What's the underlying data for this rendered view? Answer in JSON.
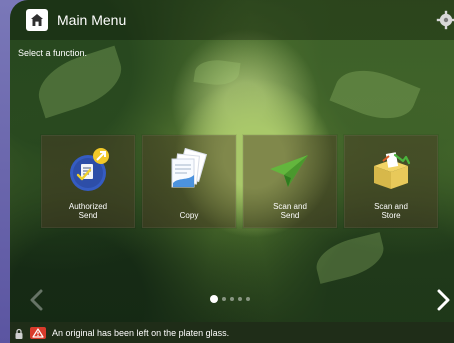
{
  "header": {
    "title": "Main Menu",
    "home_icon": "home-icon",
    "settings_icon": "gear-icon"
  },
  "main": {
    "instruction": "Select a function.",
    "tiles": [
      {
        "label": "Authorized\nSend",
        "icon": "authorized-send-icon"
      },
      {
        "label": "Copy",
        "icon": "copy-icon"
      },
      {
        "label": "Scan and\nSend",
        "icon": "scan-and-send-icon"
      },
      {
        "label": "Scan and\nStore",
        "icon": "scan-and-store-icon"
      }
    ]
  },
  "navigation": {
    "prev_icon": "chevron-left-icon",
    "next_icon": "chevron-right-icon",
    "page_count": 5,
    "active_page": 1
  },
  "status": {
    "message": "An original has been left on the platen glass.",
    "warning_icon": "warning-icon",
    "lock_icon": "lock-icon"
  },
  "colors": {
    "accent": "#d83b2c",
    "text": "#ffffff"
  }
}
